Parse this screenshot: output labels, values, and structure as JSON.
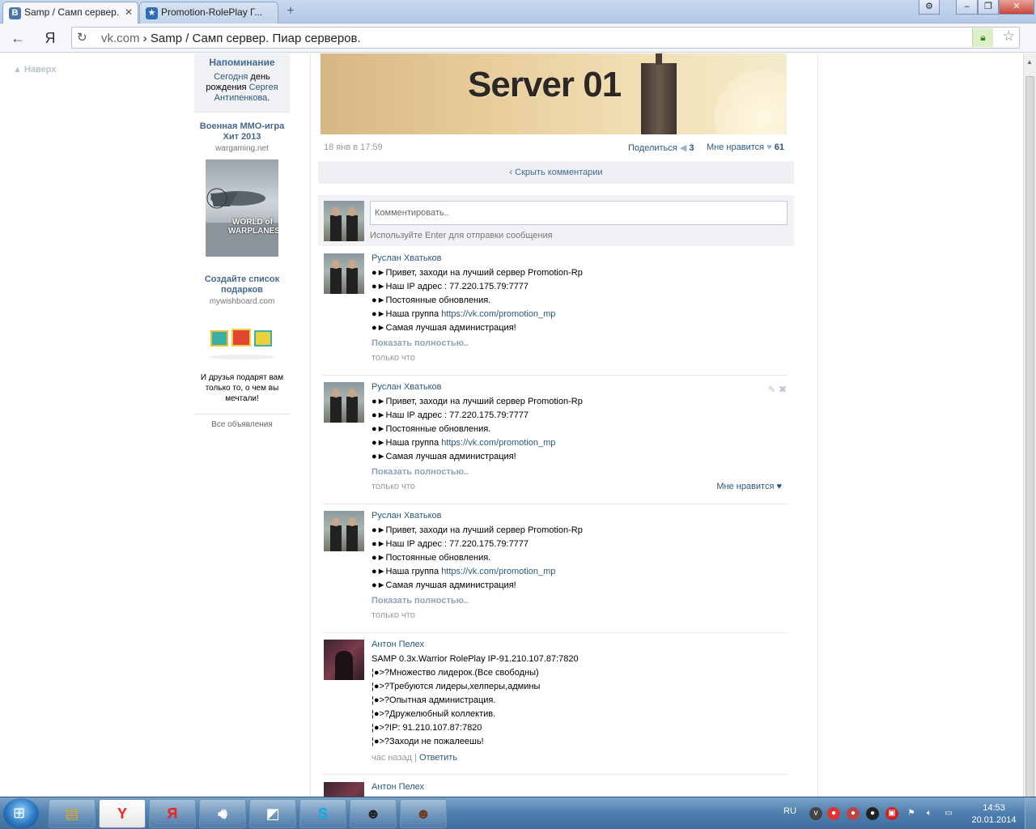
{
  "browser": {
    "tabs": [
      {
        "label": "Samp / Самп сервер.",
        "favicon": "B",
        "favicon_color": "#4a76a8",
        "active": true
      },
      {
        "label": "Promotion-RolePlay Г...",
        "favicon": "★",
        "favicon_color": "#2f6fb0",
        "active": false
      }
    ],
    "new_tab": "+",
    "omnibox": {
      "domain": "vk.com",
      "path": " › Samp / Самп сервер. Пиар серверов."
    },
    "nav": {
      "back": "←",
      "yandex": "Я"
    }
  },
  "page": {
    "to_top": "▲ Наверх",
    "sidebar": {
      "reminder": {
        "title": "Напоминание",
        "today": "Сегодня",
        "text1": " день рождения ",
        "person": "Сергея Антипенкова",
        "dot": "."
      },
      "ads": [
        {
          "title": "Военная ММО-игра Хит 2013",
          "domain": "wargaming.net",
          "image_label": "WORLD of WARPLANES"
        },
        {
          "title": "Создайте список подарков",
          "domain": "mywishboard.com",
          "desc": "И друзья подарят вам только то, о чем вы мечтали!"
        }
      ],
      "all_ads": "Все объявления"
    },
    "post": {
      "image_text": "Server 01",
      "date": "18 янв в 17:59",
      "share_label": "Поделиться",
      "share_count": "3",
      "like_label": "Мне нравится",
      "like_count": "61",
      "hide_comments": "Скрыть комментарии",
      "comment_placeholder": "Комментировать..",
      "comment_hint": "Используйте Enter для отправки сообщения"
    },
    "comments": [
      {
        "author": "Руслан Хватьков",
        "lines": [
          "●►Привет, заходи на лучший сервер Promotion-Rp",
          "●►Наш IP адрес : 77.220.175.79:7777",
          "●►Постоянные обновления.",
          "●►Наша группа ",
          "●►Самая лучшая администрация!"
        ],
        "group_link": "https://vk.com/promotion_mp",
        "more": "Показать полностью..",
        "time": "только что"
      },
      {
        "author": "Руслан Хватьков",
        "lines": [
          "●►Привет, заходи на лучший сервер Promotion-Rp",
          "●►Наш IP адрес : 77.220.175.79:7777",
          "●►Постоянные обновления.",
          "●►Наша группа ",
          "●►Самая лучшая администрация!"
        ],
        "group_link": "https://vk.com/promotion_mp",
        "more": "Показать полностью..",
        "time": "только что",
        "like": "Мне нравится ♥"
      },
      {
        "author": "Руслан Хватьков",
        "lines": [
          "●►Привет, заходи на лучший сервер Promotion-Rp",
          "●►Наш IP адрес : 77.220.175.79:7777",
          "●►Постоянные обновления.",
          "●►Наша группа ",
          "●►Самая лучшая администрация!"
        ],
        "group_link": "https://vk.com/promotion_mp",
        "more": "Показать полностью..",
        "time": "только что"
      },
      {
        "author": "Антон Пелех",
        "lines": [
          "SAMP 0.3x.Warrior RolePlay IP-91.210.107.87:7820",
          "¦●>?Множество лидерок.(Все свободны)",
          "¦●>?Требуются лидеры,хелперы,админы",
          "¦●>?Опытная администрация.",
          "¦●>?Дружелюбный коллектив.",
          "¦●>?IP: 91.210.107.87:7820",
          "¦●>?Заходи не пожалеешь!"
        ],
        "time": "час назад",
        "separator": " | ",
        "reply": "Ответить"
      },
      {
        "author": "Антон Пелех"
      }
    ]
  },
  "taskbar": {
    "lang": "RU",
    "time": "14:53",
    "date": "20.01.2014"
  },
  "colors": {
    "vk_link": "#2b587a",
    "vk_title": "#45688e",
    "taskbar": "#4f7fae"
  }
}
